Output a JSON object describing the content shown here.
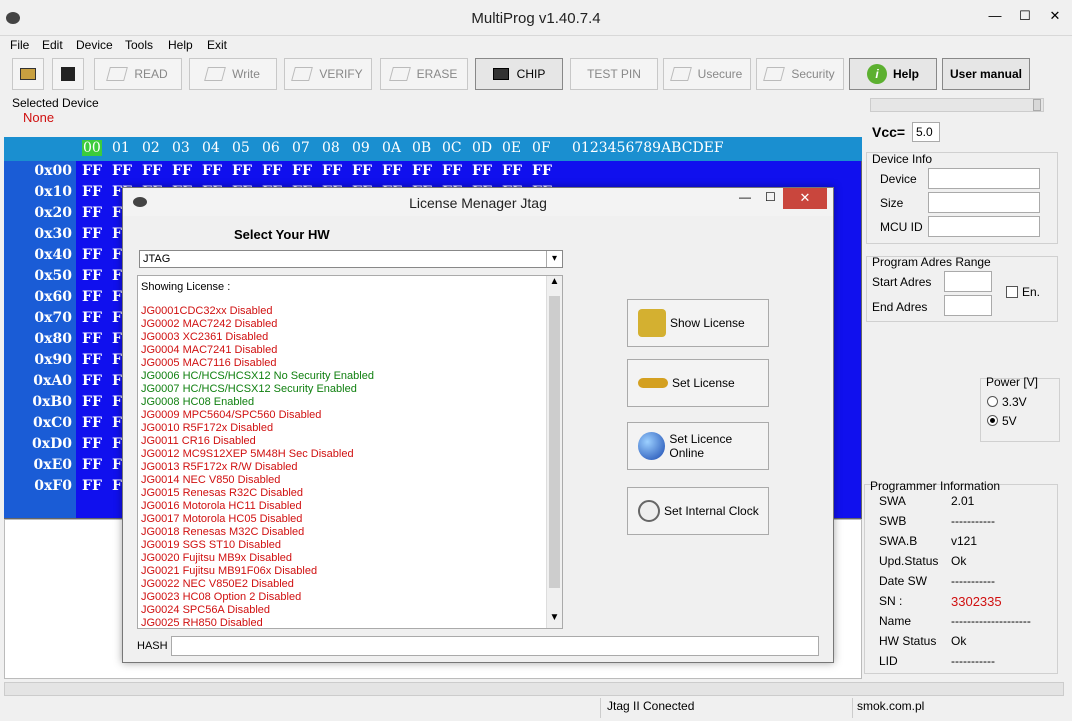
{
  "app": {
    "title": "MultiProg v1.40.7.4",
    "window_controls": {
      "minimize": "—",
      "maximize": "☐",
      "close": "✕"
    }
  },
  "menu": [
    "File",
    "Edit",
    "Device",
    "Tools",
    "Help",
    "Exit"
  ],
  "toolbar": {
    "read": "READ",
    "write": "Write",
    "verify": "VERIFY",
    "erase": "ERASE",
    "chip": "CHIP",
    "test_pin": "TEST PIN",
    "usecure": "Usecure",
    "security": "Security",
    "help": "Help",
    "user_manual": "User manual"
  },
  "selected_device": {
    "label": "Selected Device",
    "value": "None"
  },
  "hex": {
    "columns": [
      "00",
      "01",
      "02",
      "03",
      "04",
      "05",
      "06",
      "07",
      "08",
      "09",
      "0A",
      "0B",
      "0C",
      "0D",
      "0E",
      "0F"
    ],
    "ascii_header": "0123456789ABCDEF",
    "rows": [
      "0x00",
      "0x10",
      "0x20",
      "0x30",
      "0x40",
      "0x50",
      "0x60",
      "0x70",
      "0x80",
      "0x90",
      "0xA0",
      "0xB0",
      "0xC0",
      "0xD0",
      "0xE0",
      "0xF0"
    ],
    "cell_value": "FF"
  },
  "vcc": {
    "label": "Vcc=",
    "value": "5.0"
  },
  "device_info": {
    "title": "Device Info",
    "device_label": "Device",
    "size_label": "Size",
    "mcu_label": "MCU ID"
  },
  "program_range": {
    "title": "Program Adres Range",
    "start_label": "Start Adres",
    "end_label": "End  Adres",
    "enable_label": "En."
  },
  "power": {
    "title": "Power [V]",
    "opt1": "3.3V",
    "opt2": "5V"
  },
  "programmer_info": {
    "title": "Programmer Information",
    "rows": [
      {
        "k": "SWA",
        "v": "2.01"
      },
      {
        "k": "SWB",
        "v": "-----------"
      },
      {
        "k": "SWA.B",
        "v": "v121"
      },
      {
        "k": "Upd.Status",
        "v": "Ok"
      },
      {
        "k": "Date  SW",
        "v": "-----------"
      },
      {
        "k": "SN :",
        "v": "3302335"
      },
      {
        "k": "Name",
        "v": "--------------------"
      },
      {
        "k": "HW Status",
        "v": "Ok"
      },
      {
        "k": "LID",
        "v": "-----------"
      }
    ]
  },
  "dialog": {
    "title": "License Menager Jtag",
    "select_hw": "Select Your HW",
    "hw_selected": "JTAG",
    "showing": "Showing License :",
    "hash_label": "HASH",
    "btn_show": "Show License",
    "btn_set": "Set License",
    "btn_online": "Set Licence Online",
    "btn_clock": "Set Internal Clock",
    "licenses": [
      {
        "t": "JG0001CDC32xx Disabled",
        "s": "dis"
      },
      {
        "t": "JG0002 MAC7242 Disabled",
        "s": "dis"
      },
      {
        "t": "JG0003 XC2361 Disabled",
        "s": "dis"
      },
      {
        "t": "JG0004 MAC7241 Disabled",
        "s": "dis"
      },
      {
        "t": "JG0005 MAC7116 Disabled",
        "s": "dis"
      },
      {
        "t": "JG0006 HC/HCS/HCSX12 No Security Enabled",
        "s": "en"
      },
      {
        "t": "JG0007 HC/HCS/HCSX12 Security Enabled",
        "s": "en"
      },
      {
        "t": "JG0008 HC08 Enabled",
        "s": "en"
      },
      {
        "t": "JG0009 MPC5604/SPC560 Disabled",
        "s": "dis"
      },
      {
        "t": "JG0010 R5F172x Disabled",
        "s": "dis"
      },
      {
        "t": "JG0011 CR16 Disabled",
        "s": "dis"
      },
      {
        "t": "JG0012 MC9S12XEP  5M48H Sec Disabled",
        "s": "dis"
      },
      {
        "t": "JG0013 R5F172x R/W Disabled",
        "s": "dis"
      },
      {
        "t": "JG0014 NEC V850 Disabled",
        "s": "dis"
      },
      {
        "t": "JG0015 Renesas R32C Disabled",
        "s": "dis"
      },
      {
        "t": "JG0016 Motorola HC11 Disabled",
        "s": "dis"
      },
      {
        "t": "JG0017 Motorola HC05 Disabled",
        "s": "dis"
      },
      {
        "t": "JG0018 Renesas M32C Disabled",
        "s": "dis"
      },
      {
        "t": "JG0019 SGS ST10 Disabled",
        "s": "dis"
      },
      {
        "t": "JG0020 Fujitsu MB9x Disabled",
        "s": "dis"
      },
      {
        "t": "JG0021 Fujitsu MB91F06x Disabled",
        "s": "dis"
      },
      {
        "t": "JG0022 NEC V850E2 Disabled",
        "s": "dis"
      },
      {
        "t": "JG0023 HC08 Option 2 Disabled",
        "s": "dis"
      },
      {
        "t": "JG0024 SPC56A Disabled",
        "s": "dis"
      },
      {
        "t": "JG0025 RH850 Disabled",
        "s": "dis"
      }
    ]
  },
  "status": {
    "connection": "Jtag II Conected",
    "site": "smok.com.pl"
  },
  "colors": {
    "disabled": "#d01010",
    "enabled": "#108010",
    "sn": "#d01010",
    "device_none": "#d01010"
  }
}
